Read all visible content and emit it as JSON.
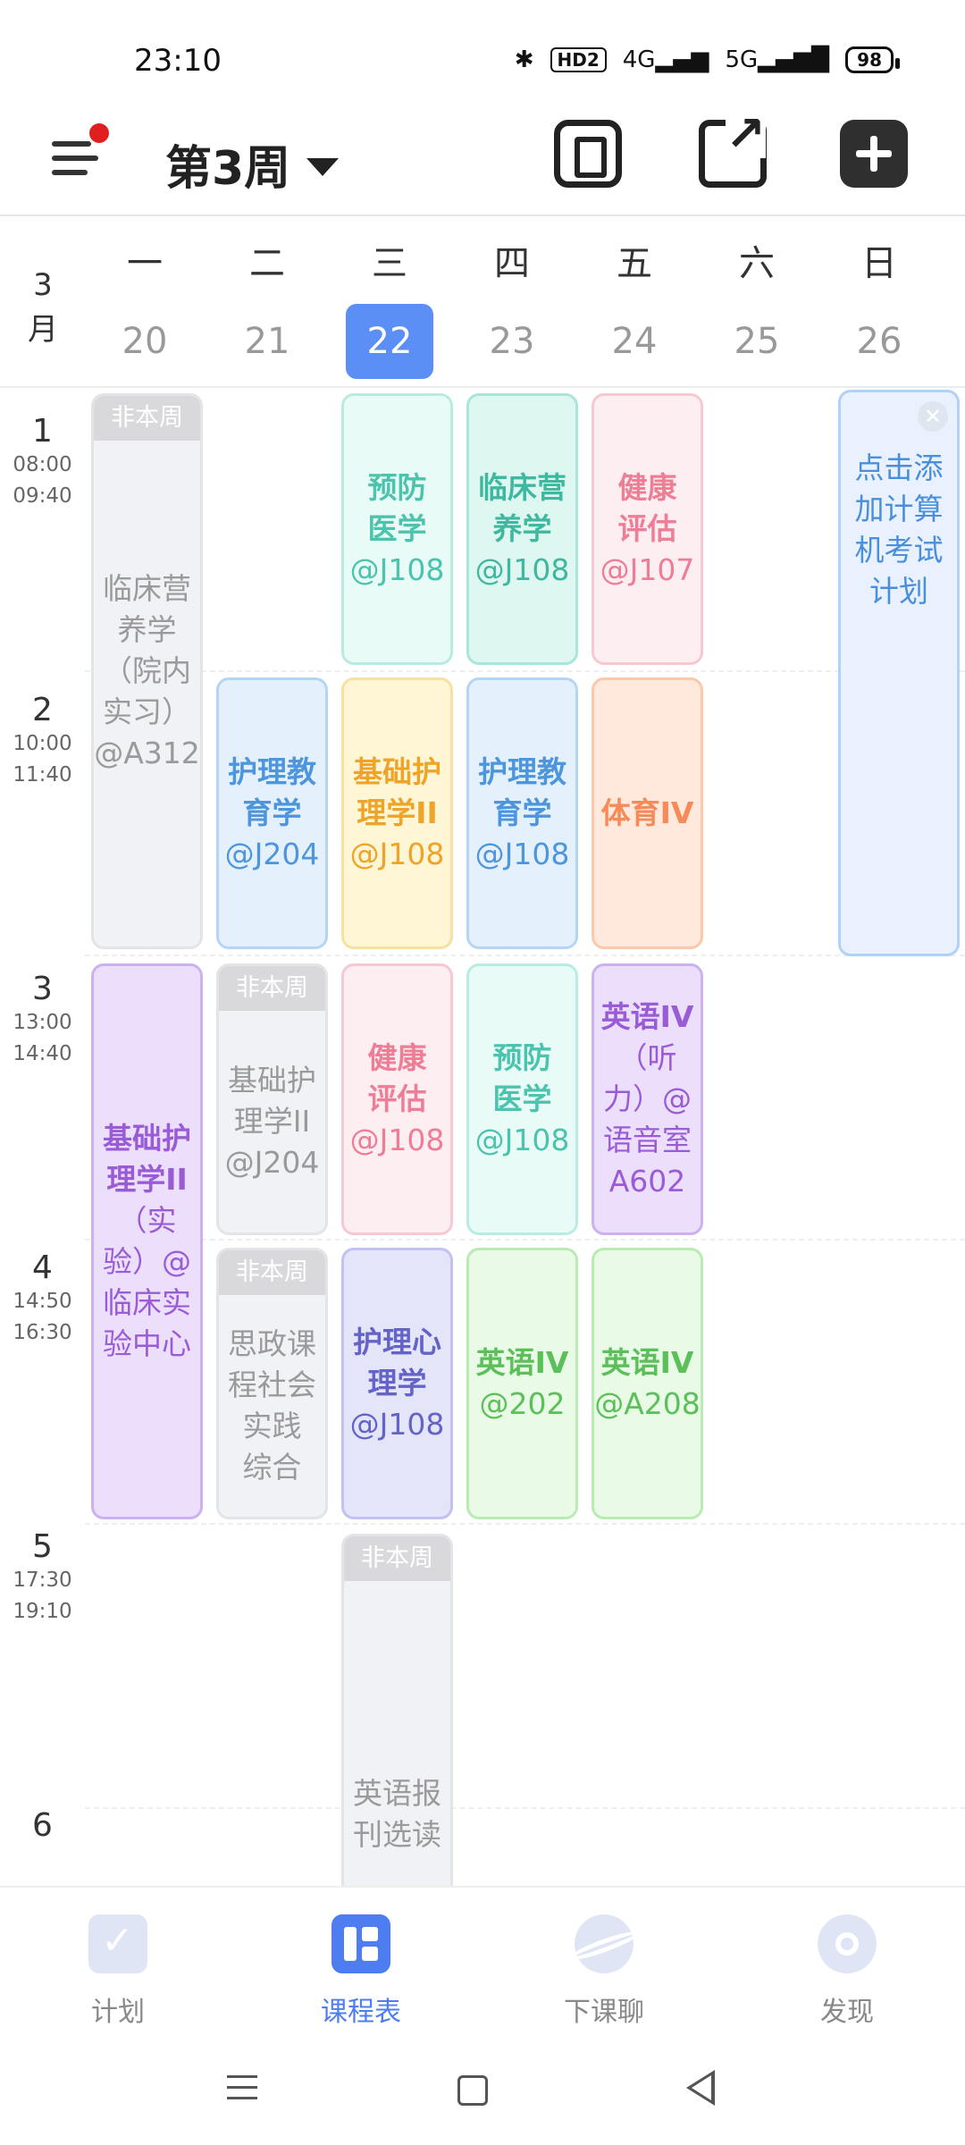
{
  "status_bar": {
    "time": "23:10",
    "hd": "HD2",
    "net1": "4G",
    "net2": "5G",
    "battery": "98"
  },
  "app_bar": {
    "week_title": "第3周"
  },
  "day_header": {
    "month_num": "3",
    "month_char": "月",
    "days": [
      {
        "name": "一",
        "date": "20"
      },
      {
        "name": "二",
        "date": "21"
      },
      {
        "name": "三",
        "date": "22"
      },
      {
        "name": "四",
        "date": "23"
      },
      {
        "name": "五",
        "date": "24"
      },
      {
        "name": "六",
        "date": "25"
      },
      {
        "name": "日",
        "date": "26"
      }
    ]
  },
  "slots": [
    {
      "n": "1",
      "start": "08:00",
      "end": "09:40"
    },
    {
      "n": "2",
      "start": "10:00",
      "end": "11:40"
    },
    {
      "n": "3",
      "start": "13:00",
      "end": "14:40"
    },
    {
      "n": "4",
      "start": "14:50",
      "end": "16:30"
    },
    {
      "n": "5",
      "start": "17:30",
      "end": "19:10"
    },
    {
      "n": "6",
      "start": "",
      "end": ""
    }
  ],
  "not_this_week": "非本周",
  "courses": {
    "mon_1": {
      "lines": [
        "临床营",
        "养学",
        "（院内",
        "实习）",
        "@A312"
      ]
    },
    "mon_3": {
      "lines": [
        "基础护",
        "理学II",
        "（实",
        "验）@",
        "临床实",
        "验中心"
      ]
    },
    "tue_2": {
      "lines": [
        "护理教",
        "育学",
        "@J204"
      ]
    },
    "tue_3": {
      "lines": [
        "基础护",
        "理学II",
        "@J204"
      ]
    },
    "tue_4": {
      "lines": [
        "思政课",
        "程社会",
        "实践",
        "综合"
      ]
    },
    "wed_1": {
      "lines": [
        "预防",
        "医学",
        "@J108"
      ]
    },
    "wed_2": {
      "lines": [
        "基础护",
        "理学II",
        "@J108"
      ]
    },
    "wed_3": {
      "lines": [
        "健康",
        "评估",
        "@J108"
      ]
    },
    "wed_4": {
      "lines": [
        "护理心",
        "理学",
        "@J108"
      ]
    },
    "wed_5": {
      "lines": [
        "英语报",
        "刊选读"
      ]
    },
    "thu_1": {
      "lines": [
        "临床营",
        "养学",
        "@J108"
      ]
    },
    "thu_2": {
      "lines": [
        "护理教",
        "育学",
        "@J108"
      ]
    },
    "thu_3": {
      "lines": [
        "预防",
        "医学",
        "@J108"
      ]
    },
    "thu_4": {
      "lines": [
        "英语IV",
        "@202"
      ]
    },
    "fri_1": {
      "lines": [
        "健康",
        "评估",
        "@J107"
      ]
    },
    "fri_2": {
      "lines": [
        "体育IV"
      ]
    },
    "fri_3": {
      "lines": [
        "英语IV",
        "（听",
        "力）@",
        "语音室",
        "A602"
      ]
    },
    "fri_4": {
      "lines": [
        "英语IV",
        "@A208"
      ]
    },
    "sun_exam": {
      "lines": [
        "点击添",
        "加计算",
        "机考试",
        "计划"
      ]
    }
  },
  "bottom_nav": [
    {
      "label": "计划",
      "icon": "plan-check-icon"
    },
    {
      "label": "课程表",
      "icon": "schedule-grid-icon"
    },
    {
      "label": "下课聊",
      "icon": "planet-chat-icon"
    },
    {
      "label": "发现",
      "icon": "discover-icon"
    }
  ],
  "accent_color": "#5b8ff5"
}
